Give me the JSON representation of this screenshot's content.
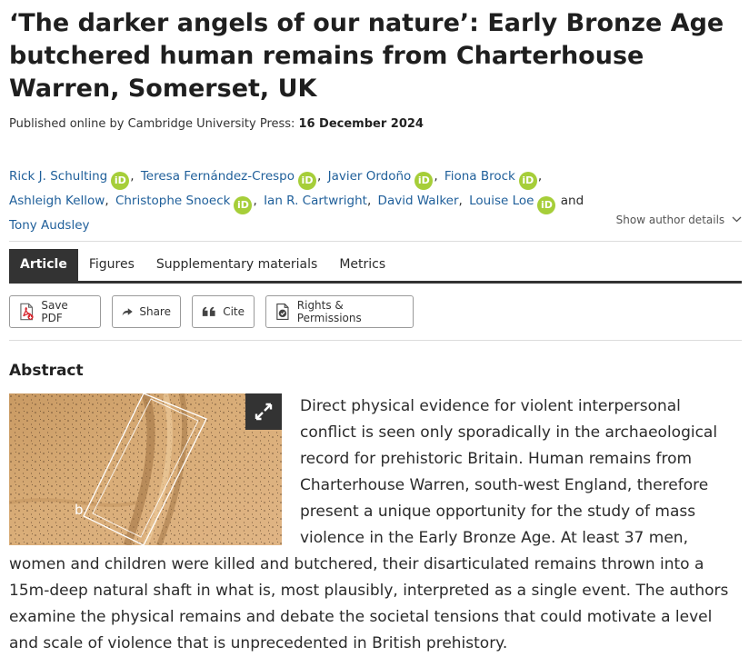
{
  "article": {
    "title": "‘The darker angels of our nature’: Early Bronze Age butchered human remains from Charterhouse Warren, Somerset, UK",
    "published_label": "Published online by Cambridge University Press:",
    "published_date": "16 December 2024"
  },
  "authors": [
    {
      "name": "Rick J. Schulting",
      "orcid": true
    },
    {
      "name": "Teresa Fernández-Crespo",
      "orcid": true
    },
    {
      "name": "Javier Ordoño",
      "orcid": true
    },
    {
      "name": "Fiona Brock",
      "orcid": true
    },
    {
      "name": "Ashleigh Kellow",
      "orcid": false
    },
    {
      "name": "Christophe Snoeck",
      "orcid": true
    },
    {
      "name": "Ian R. Cartwright",
      "orcid": false
    },
    {
      "name": "David Walker",
      "orcid": false
    },
    {
      "name": "Louise Loe",
      "orcid": true
    },
    {
      "name": "Tony Audsley",
      "orcid": false
    }
  ],
  "authors_and": "and",
  "orcid_label": "iD",
  "show_author_details": "Show author details",
  "tabs": [
    {
      "label": "Article",
      "active": true
    },
    {
      "label": "Figures",
      "active": false
    },
    {
      "label": "Supplementary materials",
      "active": false
    },
    {
      "label": "Metrics",
      "active": false
    }
  ],
  "actions": {
    "save_pdf": "Save PDF",
    "share": "Share",
    "cite": "Cite",
    "rights": "Rights & Permissions"
  },
  "abstract": {
    "heading": "Abstract",
    "figure_label": "b",
    "text": "Direct physical evidence for violent interpersonal conflict is seen only sporadically in the archaeological record for prehistoric Britain. Human remains from Charterhouse Warren, south-west England, therefore present a unique opportunity for the study of mass violence in the Early Bronze Age. At least 37 men, women and children were killed and butchered, their disarticulated remains thrown into a 15m-deep natural shaft in what is, most plausibly, interpreted as a single event. The authors examine the physical remains and debate the societal tensions that could motivate a level and scale of violence that is unprecedented in British prehistory."
  },
  "colors": {
    "link": "#1f5f9a",
    "orcid": "#a6ce39",
    "tab_active": "#333333",
    "pdf_red": "#d7262e"
  }
}
